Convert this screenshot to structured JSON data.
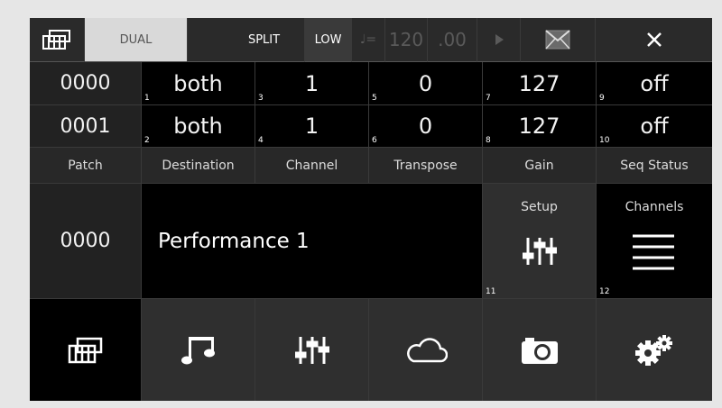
{
  "topbar": {
    "mode_icon": "piano-keys-icon",
    "dual": "DUAL",
    "split": "SPLIT",
    "low": "LOW",
    "tempo_prefix": "♩=",
    "tempo": "120",
    "tempo_decimal": ".00",
    "play_icon": "play-icon",
    "mail_icon": "envelope-icon",
    "close_icon": "close-icon"
  },
  "rows": [
    {
      "patch": "0000",
      "destination": "both",
      "dest_num": "1",
      "channel": "1",
      "channel_num": "3",
      "transpose": "0",
      "transpose_num": "5",
      "gain": "127",
      "gain_num": "7",
      "seq": "off",
      "seq_num": "9"
    },
    {
      "patch": "0001",
      "destination": "both",
      "dest_num": "2",
      "channel": "1",
      "channel_num": "4",
      "transpose": "0",
      "transpose_num": "6",
      "gain": "127",
      "gain_num": "8",
      "seq": "off",
      "seq_num": "10"
    }
  ],
  "labels": [
    "Patch",
    "Destination",
    "Channel",
    "Transpose",
    "Gain",
    "Seq Status"
  ],
  "performance": {
    "number": "0000",
    "name": "Performance 1",
    "setup_label": "Setup",
    "setup_num": "11",
    "channels_label": "Channels",
    "channels_num": "12"
  },
  "nav": [
    "piano-keys-icon",
    "music-notes-icon",
    "sliders-icon",
    "cloud-icon",
    "camera-icon",
    "gears-icon"
  ],
  "colors": {
    "background": "#000000",
    "selected": "#d9d9d9",
    "accent_dim": "#5a5a5a"
  }
}
